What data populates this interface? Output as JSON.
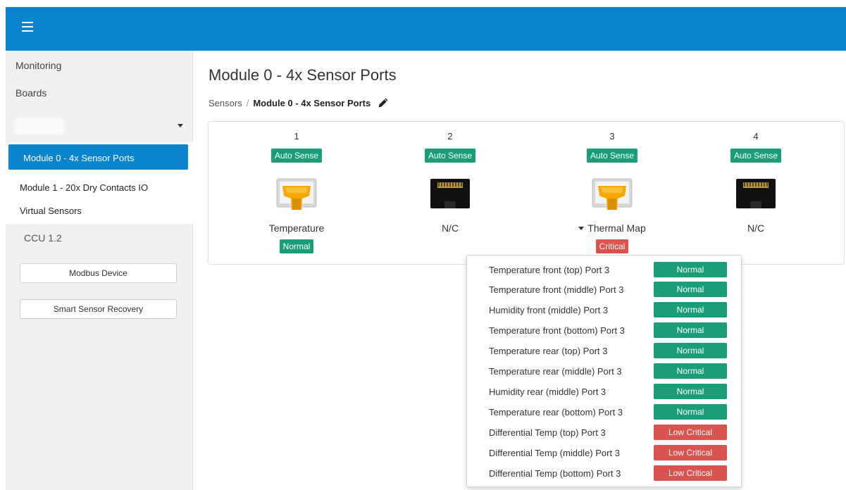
{
  "sidebar": {
    "monitoring": "Monitoring",
    "boards": "Boards",
    "modules": [
      {
        "label": "Module 0 - 4x Sensor Ports"
      },
      {
        "label": "Module 1 - 20x Dry Contacts IO"
      },
      {
        "label": "Virtual Sensors"
      }
    ],
    "ccu": "CCU 1.2",
    "buttons": [
      "Modbus Device",
      "Smart Sensor Recovery"
    ]
  },
  "main": {
    "title": "Module 0 - 4x Sensor Ports",
    "breadcrumb": {
      "parent": "Sensors",
      "separator": "/",
      "current": "Module 0 - 4x Sensor Ports"
    },
    "ports": [
      {
        "number": "1",
        "mode": "Auto Sense",
        "icon": "yellow-rj45-connected-icon",
        "label": "Temperature",
        "status": "Normal"
      },
      {
        "number": "2",
        "mode": "Auto Sense",
        "icon": "black-rj45-empty-icon",
        "label": "N/C",
        "status": ""
      },
      {
        "number": "3",
        "mode": "Auto Sense",
        "icon": "yellow-rj45-connected-icon",
        "label": "Thermal Map",
        "status": "Critical"
      },
      {
        "number": "4",
        "mode": "Auto Sense",
        "icon": "black-rj45-empty-icon",
        "label": "N/C",
        "status": ""
      }
    ]
  },
  "thermal_map_details": [
    {
      "label": "Temperature front (top) Port 3",
      "status": "Normal"
    },
    {
      "label": "Temperature front (middle) Port 3",
      "status": "Normal"
    },
    {
      "label": "Humidity front (middle) Port 3",
      "status": "Normal"
    },
    {
      "label": "Temperature front (bottom) Port 3",
      "status": "Normal"
    },
    {
      "label": "Temperature rear (top) Port 3",
      "status": "Normal"
    },
    {
      "label": "Temperature rear (middle) Port 3",
      "status": "Normal"
    },
    {
      "label": "Humidity rear (middle) Port 3",
      "status": "Normal"
    },
    {
      "label": "Temperature rear (bottom) Port 3",
      "status": "Normal"
    },
    {
      "label": "Differential Temp (top) Port 3",
      "status": "Low Critical"
    },
    {
      "label": "Differential Temp (middle) Port 3",
      "status": "Low Critical"
    },
    {
      "label": "Differential Temp (bottom) Port 3",
      "status": "Low Critical"
    }
  ],
  "colors": {
    "primary": "#0a84cf",
    "normal": "#1a9e7a",
    "critical": "#d9534f"
  }
}
